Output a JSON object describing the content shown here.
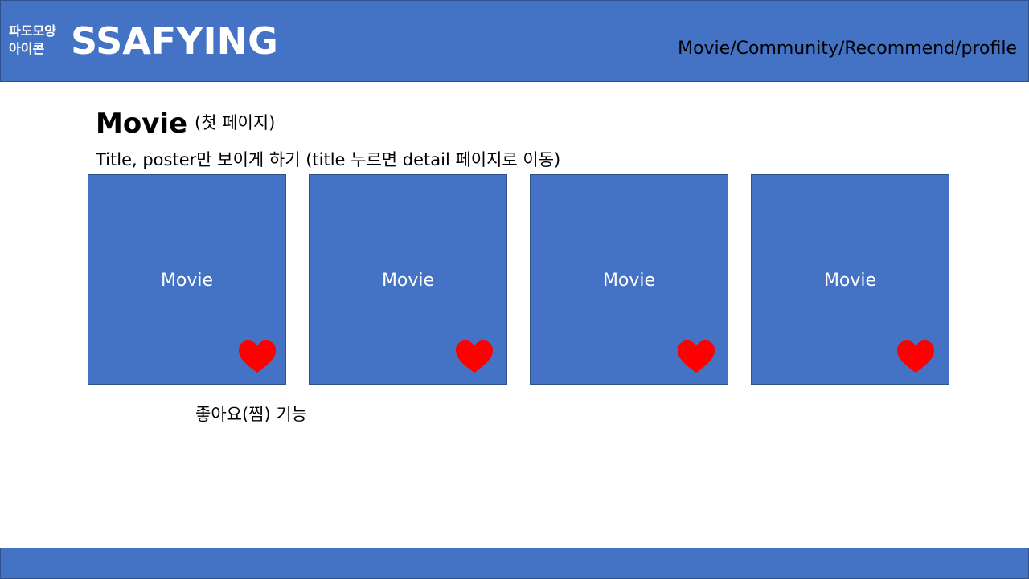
{
  "header": {
    "logo_note": "파도모양\n아이콘",
    "brand": "SSAFYING",
    "nav": [
      "Movie",
      "Community",
      "Recommend",
      "profile"
    ],
    "nav_separator": "/"
  },
  "main": {
    "title": "Movie",
    "title_note": "(첫 페이지)",
    "description": "Title, poster만 보이게 하기 (title 누르면 detail 페이지로 이동)",
    "cards": [
      {
        "label": "Movie",
        "icon": "heart-icon"
      },
      {
        "label": "Movie",
        "icon": "heart-icon"
      },
      {
        "label": "Movie",
        "icon": "heart-icon"
      },
      {
        "label": "Movie",
        "icon": "heart-icon"
      }
    ],
    "like_note": "좋아요(찜) 기능"
  },
  "colors": {
    "primary": "#4472C4",
    "border": "#2F528F",
    "heart": "#FF0000",
    "text": "#000000"
  }
}
